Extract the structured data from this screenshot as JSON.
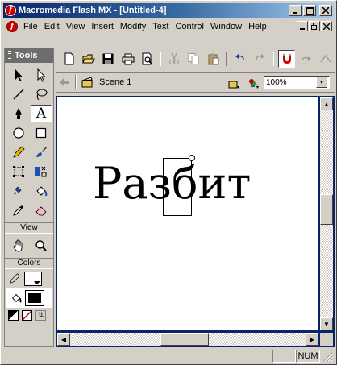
{
  "window": {
    "title": "Macromedia Flash MX - [Untitled-4]",
    "app_icon": "flash-logo-icon",
    "controls": [
      "minimize",
      "maximize",
      "close"
    ]
  },
  "menubar": {
    "items": [
      "File",
      "Edit",
      "View",
      "Insert",
      "Modify",
      "Text",
      "Control",
      "Window",
      "Help"
    ]
  },
  "tools_panel": {
    "title": "Tools",
    "tools": [
      {
        "name": "arrow",
        "icon": "arrow-icon"
      },
      {
        "name": "subselect",
        "icon": "subselect-icon"
      },
      {
        "name": "line",
        "icon": "line-icon"
      },
      {
        "name": "lasso",
        "icon": "lasso-icon"
      },
      {
        "name": "pen",
        "icon": "pen-icon"
      },
      {
        "name": "text",
        "icon": "text-icon",
        "label": "A",
        "active": true
      },
      {
        "name": "oval",
        "icon": "oval-icon"
      },
      {
        "name": "rectangle",
        "icon": "rectangle-icon"
      },
      {
        "name": "pencil",
        "icon": "pencil-icon"
      },
      {
        "name": "brush",
        "icon": "brush-icon"
      },
      {
        "name": "free-transform",
        "icon": "free-transform-icon"
      },
      {
        "name": "fill-transform",
        "icon": "fill-transform-icon"
      },
      {
        "name": "ink-bottle",
        "icon": "ink-bottle-icon"
      },
      {
        "name": "paint-bucket",
        "icon": "paint-bucket-icon"
      },
      {
        "name": "eyedropper",
        "icon": "eyedropper-icon"
      },
      {
        "name": "eraser",
        "icon": "eraser-icon"
      }
    ],
    "view_label": "View",
    "colors_label": "Colors"
  },
  "toolbar": {
    "icons": [
      "new-icon",
      "open-icon",
      "save-icon",
      "print-icon",
      "print-preview-icon",
      "cut-icon",
      "copy-icon",
      "paste-icon",
      "undo-icon",
      "redo-icon",
      "snap-magnet-icon",
      "smooth-icon",
      "straighten-icon"
    ]
  },
  "scenebar": {
    "scene_label": "Scene 1",
    "zoom_value": "100%"
  },
  "stage": {
    "text": "Разбит"
  },
  "statusbar": {
    "num": "NUM"
  }
}
